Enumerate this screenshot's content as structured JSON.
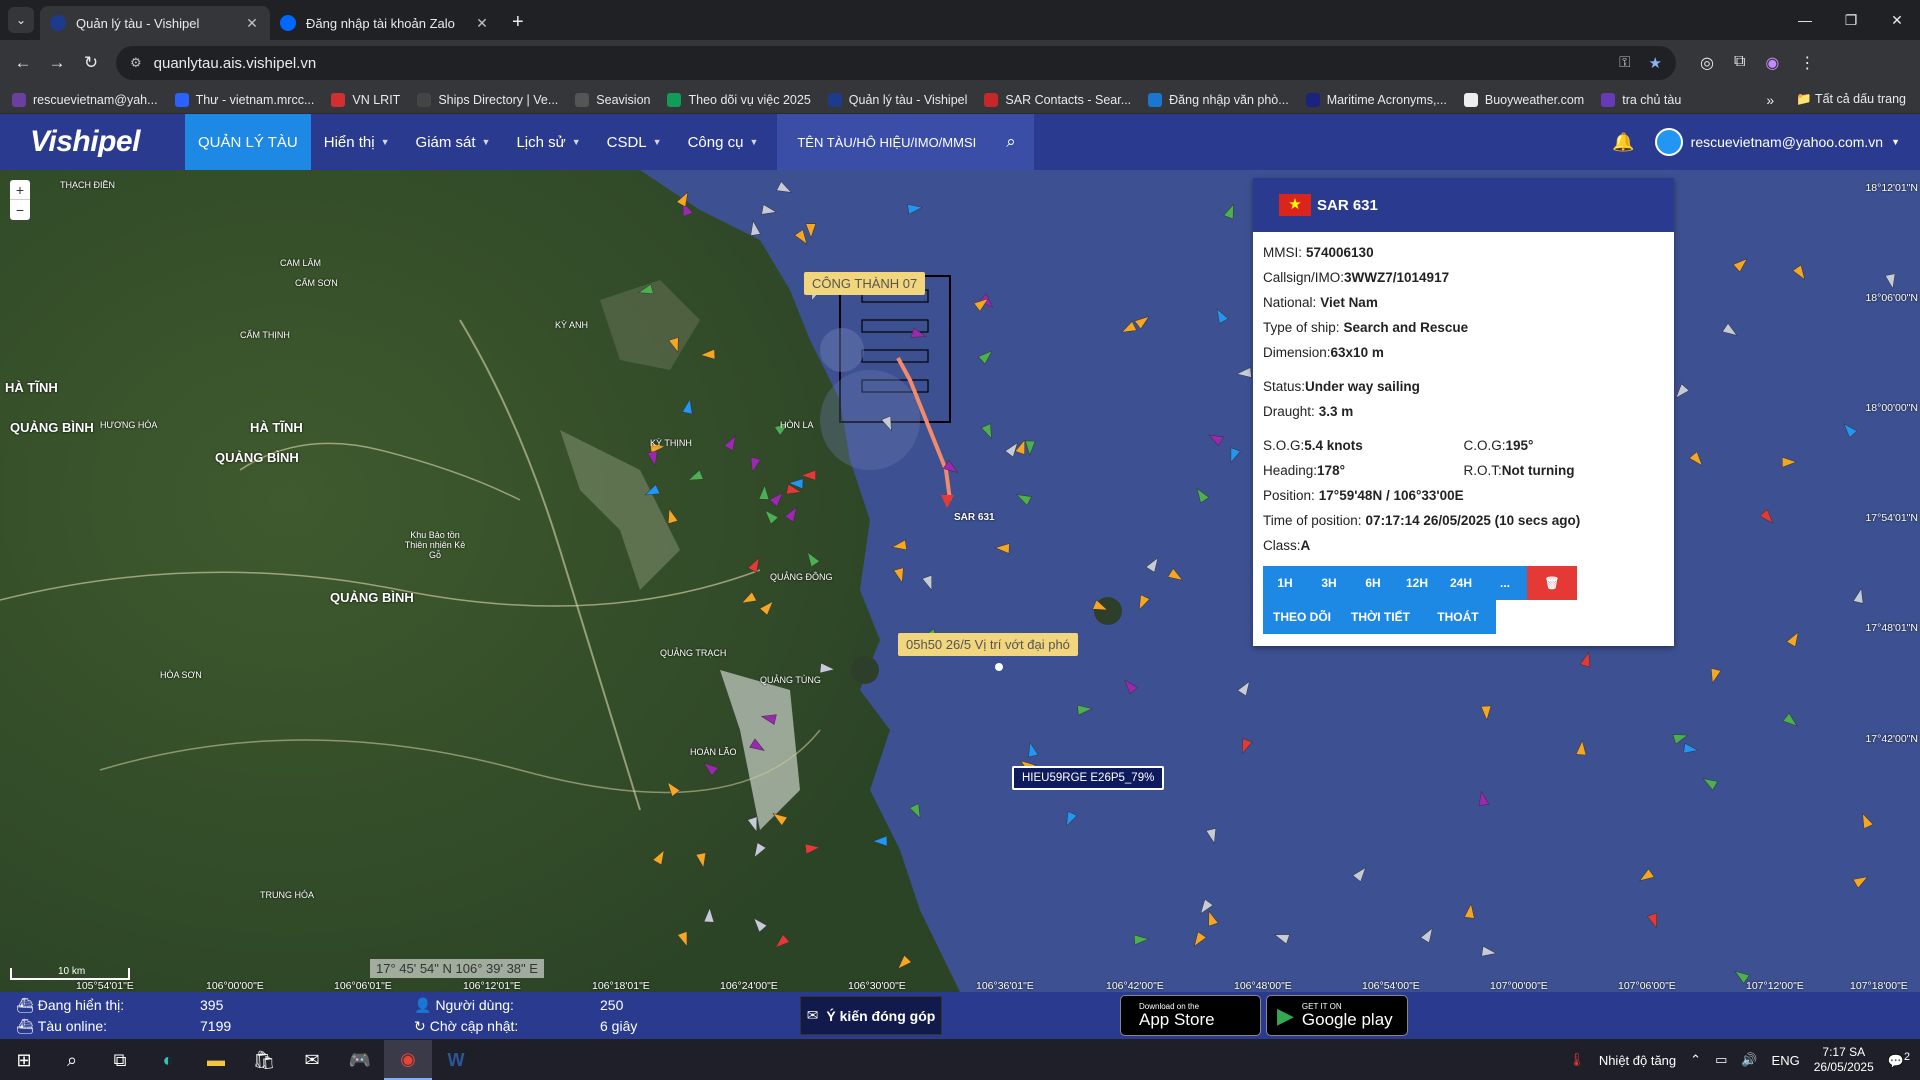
{
  "browser": {
    "tabs": [
      {
        "title": "Quản lý tàu - Vishipel",
        "active": true
      },
      {
        "title": "Đăng nhập tài khoản Zalo",
        "active": false
      }
    ],
    "url": "quanlytau.ais.vishipel.vn",
    "bookmarks": [
      "rescuevietnam@yah...",
      "Thư - vietnam.mrcc...",
      "VN LRIT",
      "Ships Directory | Ve...",
      "Seavision",
      "Theo dõi vụ việc 2025",
      "Quản lý tàu - Vishipel",
      "SAR Contacts - Sear...",
      "Đăng nhập văn phò...",
      "Maritime Acronyms,...",
      "Buoyweather.com",
      "tra chủ tàu"
    ],
    "bookmarks_more": "»",
    "all_bookmarks": "Tất cả dấu trang"
  },
  "app": {
    "logo": "Vishipel",
    "menu": [
      {
        "label": "QUẢN LÝ TÀU",
        "active": true,
        "dropdown": false
      },
      {
        "label": "Hiển thị",
        "active": false,
        "dropdown": true
      },
      {
        "label": "Giám sát",
        "active": false,
        "dropdown": true
      },
      {
        "label": "Lịch sử",
        "active": false,
        "dropdown": true
      },
      {
        "label": "CSDL",
        "active": false,
        "dropdown": true
      },
      {
        "label": "Công cụ",
        "active": false,
        "dropdown": true
      }
    ],
    "search_placeholder": "TÊN TÀU/HÔ HIỆU/IMO/MMSI",
    "user": "rescuevietnam@yahoo.com.vn"
  },
  "map": {
    "tags": {
      "cong_thanh": "CÔNG THÀNH 07",
      "wreck_note": "05h50 26/5 Vị trí vớt đại phó",
      "hieu": "HIEU59RGE E26P5_79%",
      "sar_label": "SAR 631"
    },
    "places": [
      "THẠCH ĐIỀN",
      "HÀ TĨNH",
      "QUẢNG BÌNH",
      "HÀ TĨNH",
      "QUẢNG BÌNH",
      "HƯƠNG HÓA",
      "QUẢNG BÌNH",
      "Khu Bảo tồn Thiên nhiên Kẻ Gỗ",
      "KỲ ANH",
      "HÒN LA",
      "KỲ THỊNH",
      "QUẢNG ĐÔNG",
      "QUẢNG TRẠCH",
      "QUẢNG TÙNG",
      "HOÀN LÃO",
      "CAM LÂM",
      "CẨM SƠN",
      "CẨM THỊNH",
      "HÒA SƠN",
      "TRUNG HÓA"
    ],
    "latitudes": [
      "18°12'01\"N",
      "18°06'00\"N",
      "18°00'00\"N",
      "17°54'01\"N",
      "17°48'01\"N",
      "17°42'00\"N"
    ],
    "longitudes": [
      "105°54'01\"E",
      "106°00'00\"E",
      "106°06'01\"E",
      "106°12'01\"E",
      "106°18'01\"E",
      "106°24'00\"E",
      "106°30'00\"E",
      "106°36'01\"E",
      "106°42'00\"E",
      "106°48'00\"E",
      "106°54'00\"E",
      "107°00'00\"E",
      "107°06'00\"E",
      "107°12'00\"E",
      "107°18'00\"E"
    ],
    "scale": "10 km",
    "cursor_coord": "17° 45' 54\" N 106° 39' 38\" E"
  },
  "ship_panel": {
    "name": "SAR 631",
    "flag_color": "#da251d",
    "rows": [
      {
        "k": "MMSI:",
        "v": "574006130"
      },
      {
        "k": "Callsign/IMO:",
        "v": "3WWZ7/1014917"
      },
      {
        "k": "National:",
        "v": "Viet Nam"
      },
      {
        "k": "Type of ship:",
        "v": "Search and Rescue"
      },
      {
        "k": "Dimension:",
        "v": "63x10 m"
      }
    ],
    "status_label": "Status:",
    "status": "Under way sailing",
    "draught_label": "Draught:",
    "draught": "3.3 m",
    "sog_label": "S.O.G:",
    "sog": "5.4 knots",
    "cog_label": "C.O.G:",
    "cog": "195°",
    "heading_label": "Heading:",
    "heading": "178°",
    "rot_label": "R.O.T:",
    "rot": "Not turning",
    "position_label": "Position:",
    "position": "17°59'48N / 106°33'00E",
    "time_label": "Time of position:",
    "time": "07:17:14 26/05/2025 (10 secs ago)",
    "class_label": "Class:",
    "class": "A",
    "history_buttons": [
      "1H",
      "3H",
      "6H",
      "12H",
      "24H",
      "..."
    ],
    "action_buttons": [
      "THEO DÕI",
      "THỜI TIẾT",
      "THOÁT"
    ]
  },
  "footer": {
    "displaying_label": "Đang hiển thị:",
    "displaying": "395",
    "online_label": "Tàu online:",
    "online": "7199",
    "users_label": "Người dùng:",
    "users": "250",
    "wait_label": "Chờ cập nhật:",
    "wait": "6 giây",
    "feedback": "Ý kiến đóng góp",
    "appstore_small": "Download on the",
    "appstore": "App Store",
    "gplay_small": "GET IT ON",
    "gplay": "Google play"
  },
  "taskbar": {
    "weather": "Nhiệt độ tăng",
    "lang": "ENG",
    "time": "7:17 SA",
    "date": "26/05/2025",
    "notif": "2"
  },
  "colors": {
    "app_blue": "#2a3b8f",
    "accent": "#1e88e5",
    "sea": "#3d5192"
  }
}
